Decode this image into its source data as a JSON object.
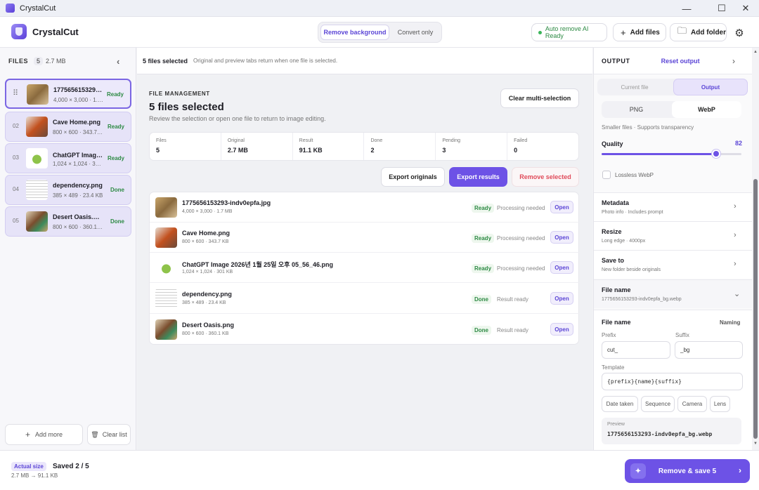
{
  "window": {
    "title": "CrystalCut",
    "minimize": "—",
    "maximize": "☐",
    "close": "✕"
  },
  "header": {
    "brand": "CrystalCut",
    "mode_tabs": [
      {
        "label": "Remove background"
      },
      {
        "label": "Convert only"
      }
    ],
    "auto_remove": "Auto remove AI Ready",
    "add_files": "Add files",
    "add_folder": "Add folder",
    "settings_icon": "gear-icon"
  },
  "sidebar": {
    "title": "FILES",
    "count": "5",
    "size": "2.7 MB",
    "items": [
      {
        "num": "",
        "name": "1775656153293-indv0epfa.jpg",
        "meta": "4,000 × 3,000 · 1.7 MB",
        "status": "Ready"
      },
      {
        "num": "02",
        "name": "Cave Home.png",
        "meta": "800 × 600 · 343.7 KB",
        "status": "Ready"
      },
      {
        "num": "03",
        "name": "ChatGPT Image 2026년 1월 25일 오후 05_56_46.png",
        "meta": "1,024 × 1,024 · 301 KB",
        "status": "Ready"
      },
      {
        "num": "04",
        "name": "dependency.png",
        "meta": "385 × 489 · 23.4 KB",
        "status": "Done"
      },
      {
        "num": "05",
        "name": "Desert Oasis.png",
        "meta": "800 × 600 · 360.1 KB",
        "status": "Done"
      }
    ],
    "add_more": "Add more",
    "clear_list": "Clear list"
  },
  "center": {
    "selbar_title": "5 files selected",
    "selbar_hint": "Original and preview tabs return when one file is selected.",
    "section": "FILE MANAGEMENT",
    "title": "5 files selected",
    "subtitle": "Review the selection or open one file to return to image editing.",
    "clear_multi": "Clear multi-selection",
    "stats": [
      {
        "label": "Files",
        "value": "5"
      },
      {
        "label": "Original",
        "value": "2.7 MB"
      },
      {
        "label": "Result",
        "value": "91.1 KB"
      },
      {
        "label": "Done",
        "value": "2"
      },
      {
        "label": "Pending",
        "value": "3"
      },
      {
        "label": "Failed",
        "value": "0"
      }
    ],
    "export_originals": "Export originals",
    "export_results": "Export results",
    "remove_selected": "Remove selected",
    "rows": [
      {
        "name": "1775656153293-indv0epfa.jpg",
        "meta": "4,000 × 3,000 · 1.7 MB",
        "status": "Ready",
        "note": "Processing needed",
        "open": "Open"
      },
      {
        "name": "Cave Home.png",
        "meta": "800 × 600 · 343.7 KB",
        "status": "Ready",
        "note": "Processing needed",
        "open": "Open"
      },
      {
        "name": "ChatGPT Image 2026년 1월 25일 오후 05_56_46.png",
        "meta": "1,024 × 1,024 · 301 KB",
        "status": "Ready",
        "note": "Processing needed",
        "open": "Open"
      },
      {
        "name": "dependency.png",
        "meta": "385 × 489 · 23.4 KB",
        "status": "Done",
        "note": "Result ready",
        "open": "Open"
      },
      {
        "name": "Desert Oasis.png",
        "meta": "800 × 600 · 360.1 KB",
        "status": "Done",
        "note": "Result ready",
        "open": "Open"
      }
    ]
  },
  "output": {
    "title": "OUTPUT",
    "reset": "Reset output",
    "tabs": [
      {
        "label": "Current file"
      },
      {
        "label": "Output"
      }
    ],
    "formats": [
      {
        "label": "PNG"
      },
      {
        "label": "WebP"
      }
    ],
    "format_hint": "Smaller files · Supports transparency",
    "quality_label": "Quality",
    "quality_value": "82",
    "quality_fraction": 0.82,
    "lossless": "Lossless WebP",
    "metadata": {
      "title": "Metadata",
      "sub": "Photo info · Includes prompt"
    },
    "resize": {
      "title": "Resize",
      "sub": "Long edge · 4000px"
    },
    "save_to": {
      "title": "Save to",
      "sub": "New folder beside originals"
    },
    "file_name": {
      "title": "File name",
      "sub": "1775656153293-indv0epfa_bg.webp"
    },
    "naming": {
      "title": "File name",
      "mode": "Naming",
      "prefix_label": "Prefix",
      "prefix": "cut_",
      "suffix_label": "Suffix",
      "suffix": "_bg",
      "template_label": "Template",
      "template": "{prefix}{name}{suffix}",
      "chips": [
        "Date taken",
        "Sequence",
        "Camera",
        "Lens"
      ],
      "preview_label": "Preview",
      "preview": "1775656153293-indv0epfa_bg.webp"
    }
  },
  "footer": {
    "actual": "Actual size",
    "saved": "Saved 2 / 5",
    "sizes": "2.7 MB → 91.1 KB",
    "save_button": "Remove & save 5"
  }
}
